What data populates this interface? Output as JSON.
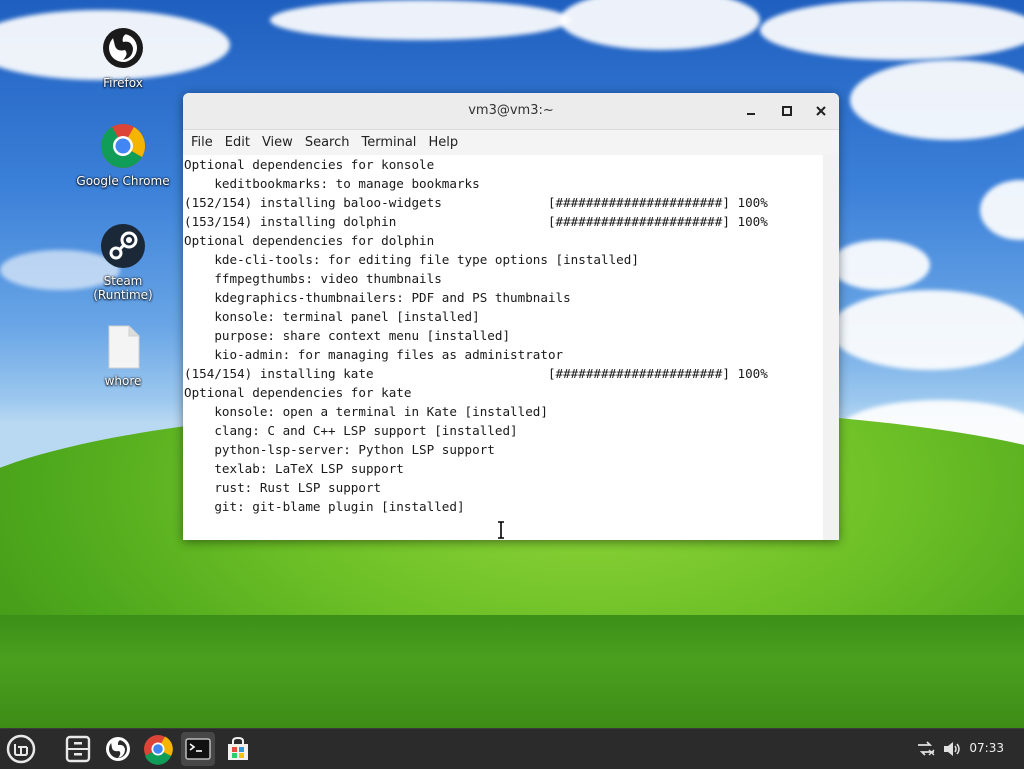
{
  "desktop": {
    "icons": [
      {
        "label": "Firefox",
        "icon": "firefox-icon"
      },
      {
        "label": "Google Chrome",
        "icon": "chrome-icon"
      },
      {
        "label": "Steam (Runtime)",
        "icon": "steam-icon"
      },
      {
        "label": "whore",
        "icon": "file-icon"
      }
    ]
  },
  "terminal": {
    "title": "vm3@vm3:~",
    "menu": [
      "File",
      "Edit",
      "View",
      "Search",
      "Terminal",
      "Help"
    ],
    "lines": [
      "Optional dependencies for konsole",
      "    keditbookmarks: to manage bookmarks",
      "(152/154) installing baloo-widgets              [######################] 100%",
      "(153/154) installing dolphin                    [######################] 100%",
      "Optional dependencies for dolphin",
      "    kde-cli-tools: for editing file type options [installed]",
      "    ffmpegthumbs: video thumbnails",
      "    kdegraphics-thumbnailers: PDF and PS thumbnails",
      "    konsole: terminal panel [installed]",
      "    purpose: share context menu [installed]",
      "    kio-admin: for managing files as administrator",
      "(154/154) installing kate                       [######################] 100%",
      "Optional dependencies for kate",
      "    konsole: open a terminal in Kate [installed]",
      "    clang: C and C++ LSP support [installed]",
      "    python-lsp-server: Python LSP support",
      "    texlab: LaTeX LSP support",
      "    rust: Rust LSP support",
      "    git: git-blame plugin [installed]"
    ],
    "scroll_position": 1.0
  },
  "taskbar": {
    "apps": [
      "mint-menu-icon",
      "file-manager-icon",
      "firefox-icon",
      "chrome-icon",
      "terminal-icon",
      "software-manager-icon"
    ],
    "active": "terminal-icon",
    "tray": [
      "network-icon",
      "volume-icon"
    ],
    "clock": "07:33"
  }
}
